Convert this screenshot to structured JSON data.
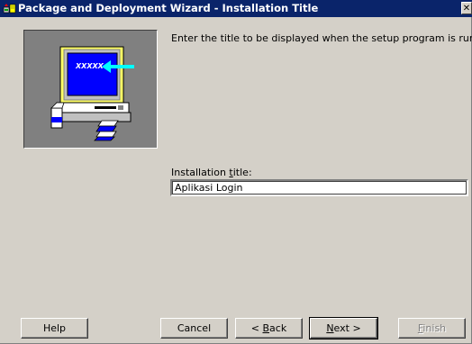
{
  "window": {
    "title": "Package and Deployment Wizard - Installation Title",
    "close_glyph": "✕"
  },
  "main": {
    "instruction": "Enter the title to be displayed when the setup program is run.",
    "illustration": {
      "screen_text": "XXXXX",
      "icon": "computer-setup-illustration-icon"
    },
    "field_label_prefix": "Installation ",
    "field_label_access": "t",
    "field_label_suffix": "itle:",
    "field_value": "Aplikasi Login"
  },
  "buttons": {
    "help": "Help",
    "cancel": "Cancel",
    "back_prefix": "< ",
    "back_access": "B",
    "back_suffix": "ack",
    "next_access": "N",
    "next_suffix": "ext >",
    "finish_access": "F",
    "finish_suffix": "inish"
  },
  "colors": {
    "titlebar": "#0a246a",
    "dialog_face": "#d4d0c8",
    "screen_blue": "#0000ff",
    "arrow_cyan": "#00ffff"
  }
}
